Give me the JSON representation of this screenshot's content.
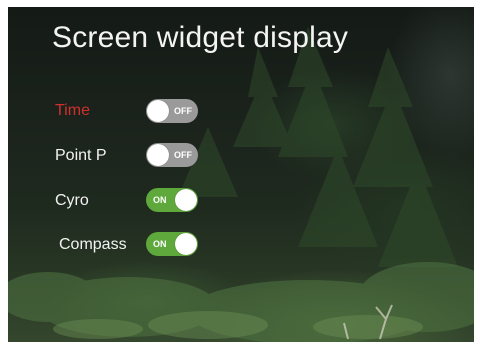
{
  "title": "Screen widget display",
  "colors": {
    "active_label": "#d0302c",
    "toggle_on": "#5fa83c",
    "toggle_off": "#9a9a9a"
  },
  "widgets": [
    {
      "label": "Time",
      "state": "off",
      "toggle_text": "OFF",
      "active": true
    },
    {
      "label": "Point P",
      "state": "off",
      "toggle_text": "OFF",
      "active": false
    },
    {
      "label": "Cyro",
      "state": "on",
      "toggle_text": "ON",
      "active": false
    },
    {
      "label": "Compass",
      "state": "on",
      "toggle_text": "ON",
      "active": false
    }
  ]
}
